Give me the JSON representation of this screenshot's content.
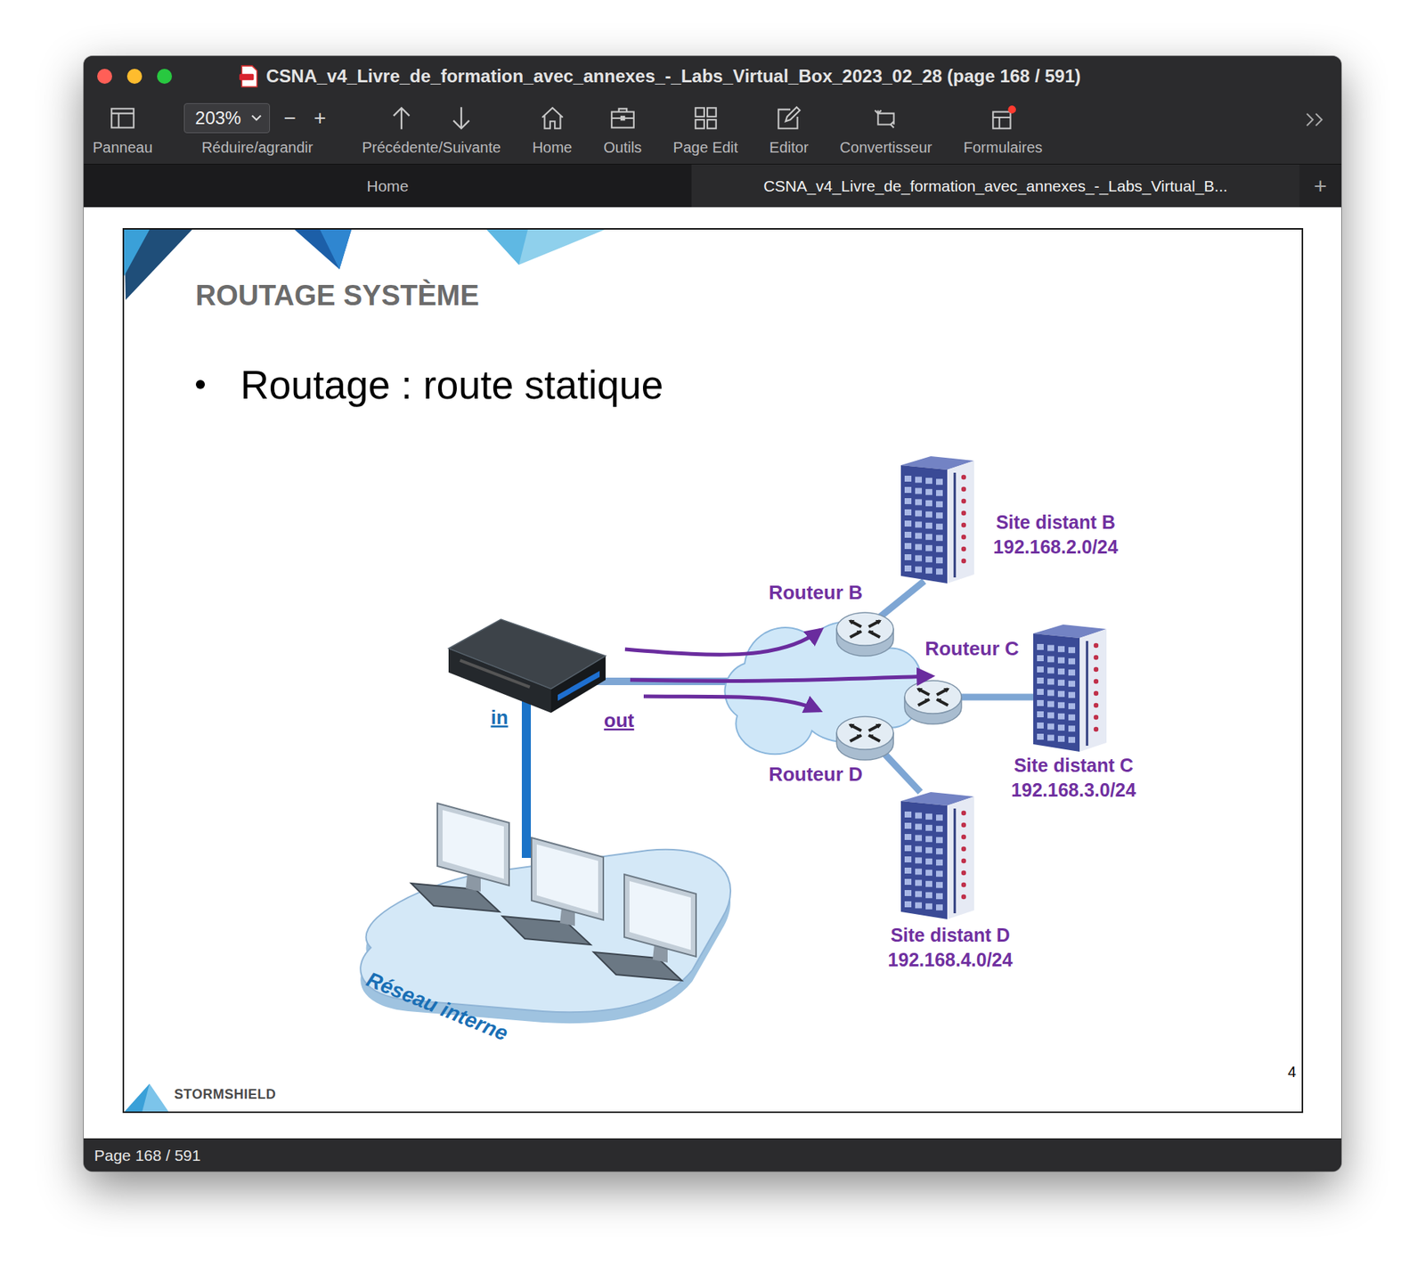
{
  "window": {
    "title": "CSNA_v4_Livre_de_formation_avec_annexes_-_Labs_Virtual_Box_2023_02_28 (page 168 / 591)"
  },
  "toolbar": {
    "items": [
      {
        "label": "Panneau",
        "kind": "button",
        "badge": false
      },
      {
        "label": "Réduire/agrandir",
        "kind": "zoom",
        "value": "203%",
        "minus": "−",
        "plus": "+",
        "badge": false
      },
      {
        "label": "Précédente/Suivante",
        "kind": "nav",
        "badge": false
      },
      {
        "label": "Home",
        "kind": "button",
        "badge": false
      },
      {
        "label": "Outils",
        "kind": "button",
        "badge": false
      },
      {
        "label": "Page Edit",
        "kind": "button",
        "badge": false
      },
      {
        "label": "Editor",
        "kind": "button",
        "badge": false
      },
      {
        "label": "Convertisseur",
        "kind": "button",
        "badge": false
      },
      {
        "label": "Formulaires",
        "kind": "button",
        "badge": true
      }
    ]
  },
  "tabs": [
    {
      "label": "Home",
      "selected": false
    },
    {
      "label": "CSNA_v4_Livre_de_formation_avec_annexes_-_Labs_Virtual_B...",
      "selected": true
    }
  ],
  "new_tab": "+",
  "slide": {
    "title": "ROUTAGE SYSTÈME",
    "bullet": "Routage : route statique",
    "firewall": {
      "in": "in",
      "out": "out"
    },
    "routers": [
      {
        "label": "Routeur B"
      },
      {
        "label": "Routeur C"
      },
      {
        "label": "Routeur D"
      }
    ],
    "sites": [
      {
        "name": "Site distant B",
        "network": "192.168.2.0/24"
      },
      {
        "name": "Site distant C",
        "network": "192.168.3.0/24"
      },
      {
        "name": "Site distant D",
        "network": "192.168.4.0/24"
      }
    ],
    "lan": "Réseau interne",
    "logo": "STORMSHIELD",
    "page_number": "4"
  },
  "status_bar": {
    "text": "Page 168 / 591"
  }
}
